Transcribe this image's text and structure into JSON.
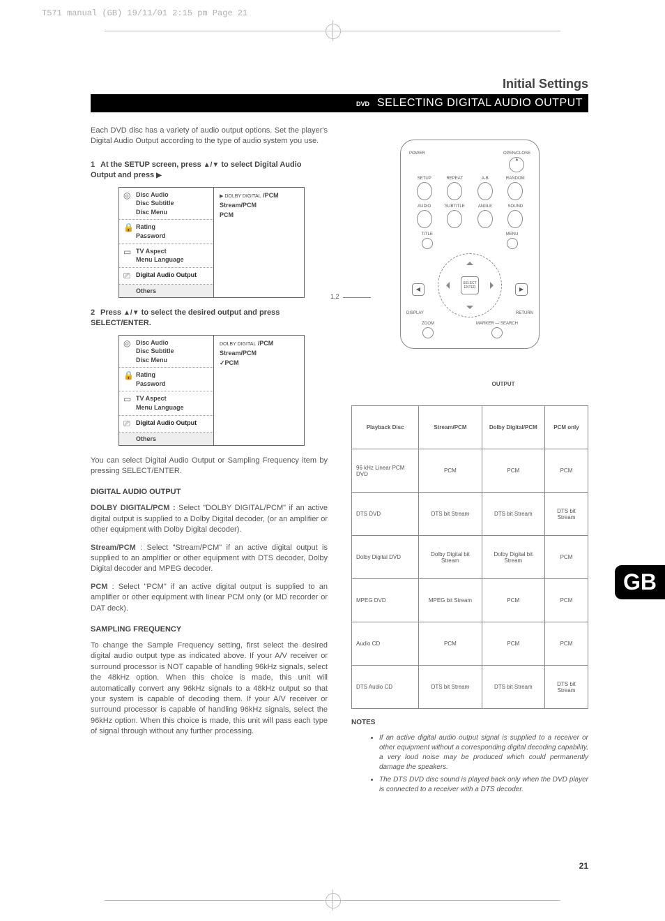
{
  "header_info": "T571 manual (GB)  19/11/01  2:15 pm  Page 21",
  "section_title": "Initial Settings",
  "section_bar_dvd": "DVD",
  "section_bar_text": "SELECTING DIGITAL AUDIO OUTPUT",
  "intro": "Each DVD disc has a variety of audio output options. Set the player's Digital Audio Output according to the type of audio system you use.",
  "step1": {
    "num": "1",
    "text_a": "At the SETUP screen, press ",
    "text_b": " to select Digital Audio Output and press "
  },
  "step2": {
    "num": "2",
    "text_a": "Press ",
    "text_b": " to select the desired output and press SELECT/ENTER."
  },
  "osd": {
    "groups": [
      {
        "icon": "◎",
        "lines": [
          "Disc Audio",
          "Disc Subtitle",
          "Disc Menu"
        ]
      },
      {
        "icon": "🔒",
        "lines": [
          "Rating",
          "Password"
        ]
      },
      {
        "icon": "▭",
        "lines": [
          "TV Aspect",
          "Menu Language"
        ]
      },
      {
        "icon": "⎚",
        "lines": [
          "Digital Audio Output"
        ]
      }
    ],
    "others": "Others",
    "values1": [
      {
        "pre": "▶ DOLBY DIGITAL",
        "main": " /PCM"
      },
      {
        "pre": "",
        "main": "Stream/PCM"
      },
      {
        "pre": "",
        "main": "PCM"
      }
    ],
    "values2": [
      {
        "pre": "DOLBY DIGITAL",
        "main": " /PCM"
      },
      {
        "pre": "",
        "main": "Stream/PCM"
      },
      {
        "pre": "✓",
        "main": "PCM"
      }
    ]
  },
  "body1": "You can select Digital Audio Output or Sampling Frequency item by pressing SELECT/ENTER.",
  "heading_dao": "DIGITAL AUDIO OUTPUT",
  "dao_dolby_label": "DOLBY DIGITAL/PCM : ",
  "dao_dolby": "Select \"DOLBY DIGITAL/PCM\" if an active digital output is supplied to a Dolby Digital decoder, (or an amplifier or other equipment with Dolby Digital decoder).",
  "dao_stream_label": "Stream/PCM",
  "dao_stream": " : Select \"Stream/PCM\" if an active digital output is supplied to an amplifier or other equipment with DTS decoder, Dolby Digital decoder and MPEG decoder.",
  "dao_pcm_label": "PCM",
  "dao_pcm": " : Select \"PCM\" if an active digital output is supplied to an amplifier or other equipment with linear PCM only (or MD recorder or DAT deck).",
  "heading_sf": "SAMPLING FREQUENCY",
  "sf_text": "To change the Sample Frequency setting, first select the desired digital audio output type as indicated above. If your A/V receiver or surround processor is NOT capable of handling 96kHz signals, select the 48kHz option. When this choice is made, this unit will automatically convert any 96kHz signals to a 48kHz output so that your system is capable of decoding them. If your A/V receiver or surround processor is capable of handling 96kHz signals, select the 96kHz option. When this choice is made, this unit will pass each type of signal through without any further processing.",
  "remote": {
    "power": "POWER",
    "openclose": "OPEN/CLOSE",
    "row1": [
      "SETUP",
      "REPEAT",
      "A-B",
      "RANDOM"
    ],
    "row2": [
      "AUDIO",
      "SUBTITLE",
      "ANGLE",
      "SOUND"
    ],
    "row3": [
      "TITLE",
      "",
      "",
      "MENU"
    ],
    "select": "SELECT ENTER",
    "display": "DISPLAY",
    "return": "RETURN",
    "bottom": [
      "ZOOM",
      "MARKER — SEARCH"
    ],
    "callout": "1,2"
  },
  "table": {
    "output_header": "OUTPUT",
    "col1": "Playback Disc",
    "cols": [
      "Stream/PCM",
      "Dolby Digital/PCM",
      "PCM only"
    ],
    "rows": [
      {
        "label": "96 kHz Linear PCM DVD",
        "cells": [
          "PCM",
          "PCM",
          "PCM"
        ]
      },
      {
        "label": "DTS DVD",
        "cells": [
          "DTS bit Stream",
          "DTS bit Stream",
          "DTS bit Stream"
        ]
      },
      {
        "label": "Dolby Digital DVD",
        "cells": [
          "Dolby Digital bit Stream",
          "Dolby Digital bit Stream",
          "PCM"
        ]
      },
      {
        "label": "MPEG DVD",
        "cells": [
          "MPEG bit Stream",
          "PCM",
          "PCM"
        ]
      },
      {
        "label": "Audio CD",
        "cells": [
          "PCM",
          "PCM",
          "PCM"
        ]
      },
      {
        "label": "DTS Audio CD",
        "cells": [
          "DTS bit Stream",
          "DTS bit Stream",
          "DTS bit Stream"
        ]
      }
    ]
  },
  "notes_heading": "NOTES",
  "notes": [
    "If an active digital audio output signal is supplied to a receiver or other equipment without a corresponding digital decoding capability, a very loud noise may be produced which could permanently damage the speakers.",
    "The DTS DVD disc sound is played back only when the DVD player is connected to a receiver with a DTS decoder."
  ],
  "gb": "GB",
  "page_number": "21"
}
